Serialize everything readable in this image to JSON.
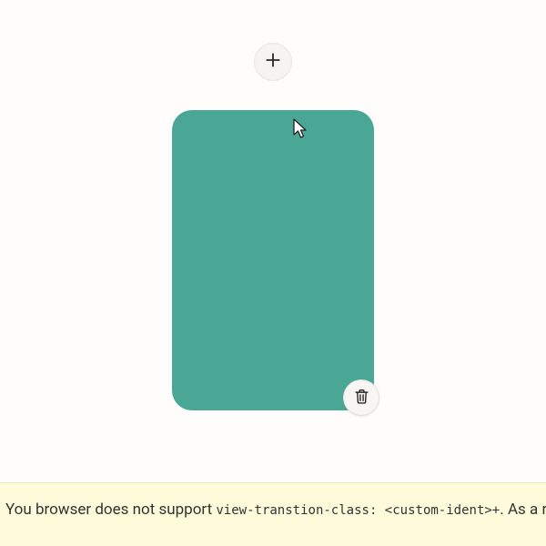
{
  "icons": {
    "add": "plus-icon",
    "delete": "trash-icon",
    "cursor": "pointer-cursor"
  },
  "card": {
    "color": "#4aa795"
  },
  "warning": {
    "prefix": "You browser does not support ",
    "code": "view-transtion-class: <custom-ident>+",
    "suffix": ". As a result, the"
  }
}
